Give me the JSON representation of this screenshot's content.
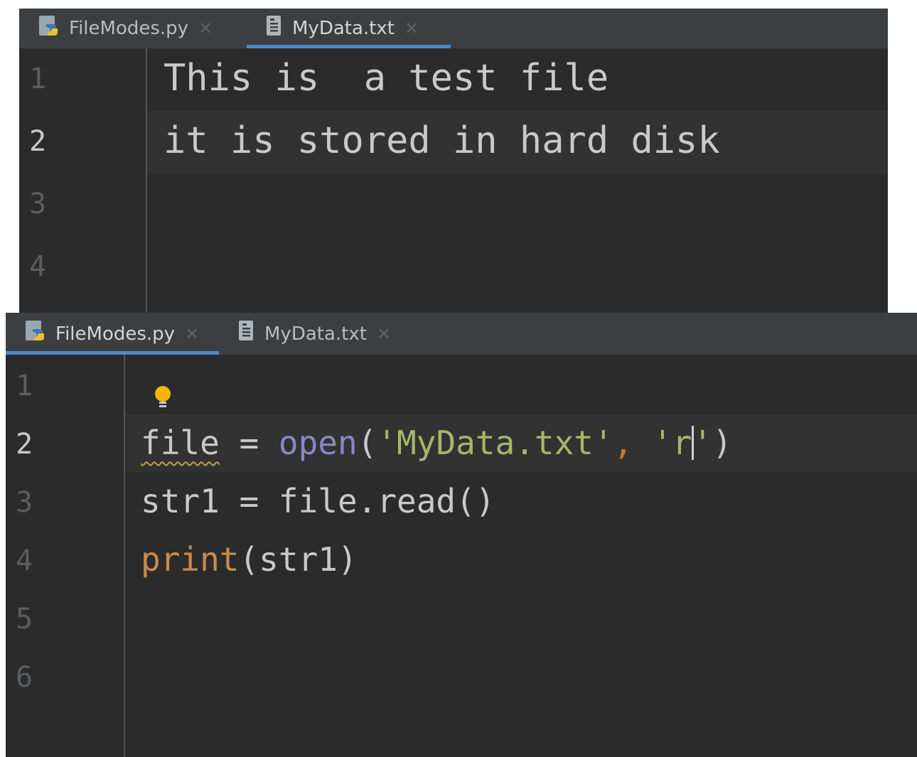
{
  "top_editor": {
    "tabs": [
      {
        "label": "FileModes.py",
        "icon": "python-file-icon",
        "active": false
      },
      {
        "label": "MyData.txt",
        "icon": "text-file-icon",
        "active": true
      }
    ],
    "line_numbers": [
      "1",
      "2",
      "3",
      "4"
    ],
    "current_line": "2",
    "lines": [
      "This is  a test file",
      "it is stored in hard disk",
      "",
      ""
    ]
  },
  "bottom_editor": {
    "tabs": [
      {
        "label": "FileModes.py",
        "icon": "python-file-icon",
        "active": true
      },
      {
        "label": "MyData.txt",
        "icon": "text-file-icon",
        "active": false
      }
    ],
    "line_numbers": [
      "1",
      "2",
      "3",
      "4",
      "5",
      "6"
    ],
    "current_line": "2",
    "code": {
      "line2": {
        "var": "file",
        "eq": " = ",
        "func": "open",
        "open_paren": "(",
        "arg1": "'MyData.txt'",
        "comma": ",",
        "space": " ",
        "arg2_before_caret": "'r",
        "arg2_after_caret": "'",
        "close_paren": ")"
      },
      "line3": "str1 = file.read()",
      "line4": {
        "func": "print",
        "args": "(str1)"
      }
    },
    "intention_icon": "lightbulb-icon"
  },
  "colors": {
    "editor_bg": "#2b2b2b",
    "tab_bar_bg": "#3c3f41",
    "tab_active_underline": "#4a88c7",
    "string": "#a6b66a",
    "builtin": "#8888c6",
    "keyword_orange": "#cc7832",
    "text": "#c9c9c9"
  }
}
